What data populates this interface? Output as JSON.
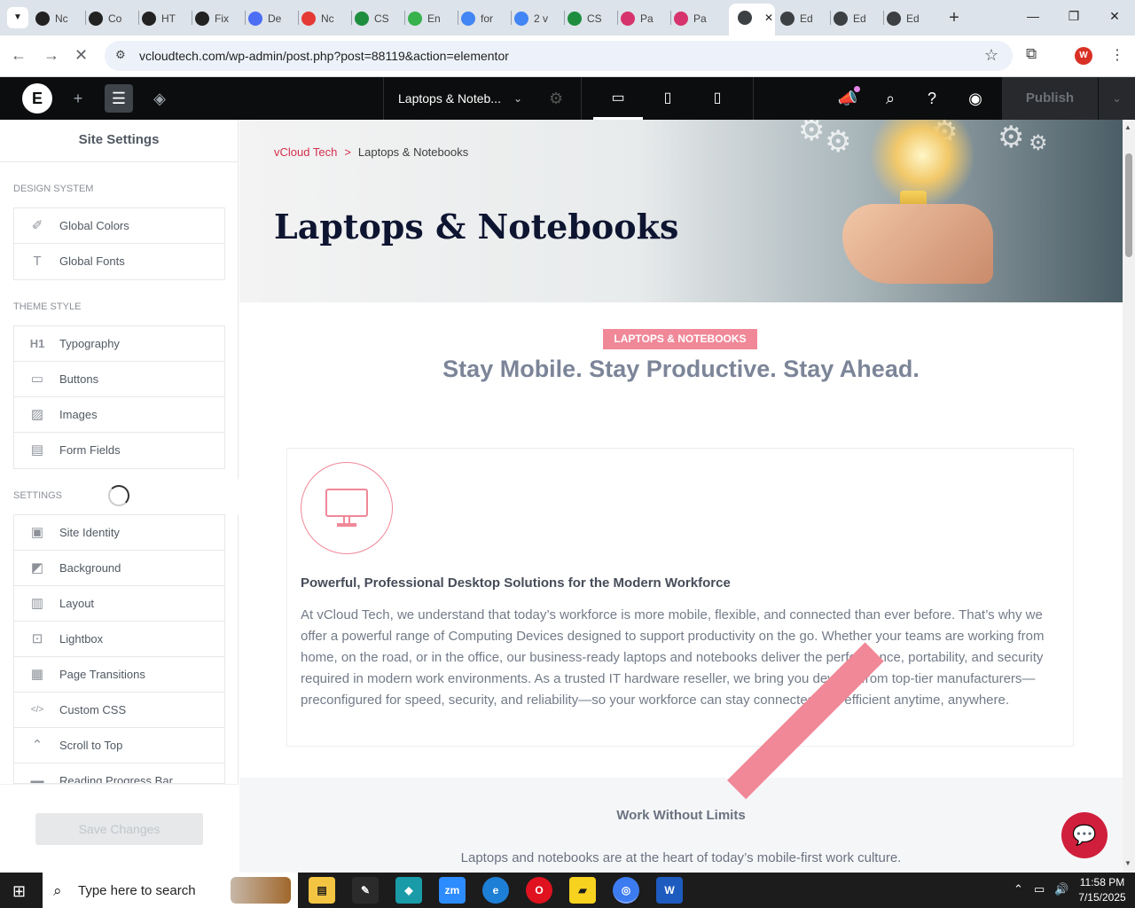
{
  "browser": {
    "tabs": [
      {
        "label": "Nc",
        "color": "#222222"
      },
      {
        "label": "Co",
        "color": "#222222"
      },
      {
        "label": "HT",
        "color": "#222222"
      },
      {
        "label": "Fix",
        "color": "#222222"
      },
      {
        "label": "De",
        "color": "#4c6ef5"
      },
      {
        "label": "Nc",
        "color": "#e53935"
      },
      {
        "label": "CS",
        "color": "#1e8e3e"
      },
      {
        "label": "En",
        "color": "#37b24d"
      },
      {
        "label": "for",
        "color": "#4285f4"
      },
      {
        "label": "2 v",
        "color": "#4285f4"
      },
      {
        "label": "CS",
        "color": "#1e8e3e"
      },
      {
        "label": "Pa",
        "color": "#d6336c"
      },
      {
        "label": "Pa",
        "color": "#d6336c"
      },
      {
        "label": "",
        "color": "#3c4043"
      },
      {
        "label": "Ed",
        "color": "#3c4043"
      },
      {
        "label": "Ed",
        "color": "#3c4043"
      },
      {
        "label": "Ed",
        "color": "#3c4043"
      }
    ],
    "url": "vcloudtech.com/wp-admin/post.php?post=88119&action=elementor",
    "profile_initial": "W"
  },
  "editor": {
    "document_title": "Laptops & Noteb...",
    "publish_label": "Publish"
  },
  "panel": {
    "title": "Site Settings",
    "design_system_label": "DESIGN SYSTEM",
    "design_system": [
      {
        "label": "Global Colors",
        "icon": "brush-icon"
      },
      {
        "label": "Global Fonts",
        "icon": "font-icon"
      }
    ],
    "theme_style_label": "THEME STYLE",
    "theme_style": [
      {
        "label": "Typography",
        "icon": "heading-icon"
      },
      {
        "label": "Buttons",
        "icon": "button-icon"
      },
      {
        "label": "Images",
        "icon": "image-icon"
      },
      {
        "label": "Form Fields",
        "icon": "form-icon"
      }
    ],
    "settings_label": "SETTINGS",
    "settings": [
      {
        "label": "Site Identity",
        "icon": "identity-icon"
      },
      {
        "label": "Background",
        "icon": "background-icon"
      },
      {
        "label": "Layout",
        "icon": "layout-icon"
      },
      {
        "label": "Lightbox",
        "icon": "lightbox-icon"
      },
      {
        "label": "Page Transitions",
        "icon": "transitions-icon"
      },
      {
        "label": "Custom CSS",
        "icon": "code-icon"
      },
      {
        "label": "Scroll to Top",
        "icon": "scroll-top-icon"
      },
      {
        "label": "Reading Progress Bar",
        "icon": "progress-icon"
      }
    ],
    "save_label": "Save Changes"
  },
  "page": {
    "breadcrumb_home": "vCloud Tech",
    "breadcrumb_sep": ">",
    "breadcrumb_current": "Laptops & Notebooks",
    "hero_title": "Laptops & Notebooks",
    "badge": "LAPTOPS & NOTEBOOKS",
    "tagline": "Stay Mobile. Stay Productive. Stay Ahead.",
    "card_heading": "Powerful, Professional Desktop Solutions for the Modern Workforce",
    "card_body": "At vCloud Tech, we understand that today’s workforce is more mobile, flexible, and connected than ever before. That’s why we offer a powerful range of Computing Devices designed to support productivity on the go. Whether your teams are working from home, on the road, or in the office, our business-ready laptops and notebooks deliver the performance, portability, and security required in modern work environments. As a trusted IT hardware reseller, we bring you devices from top-tier manufacturers—preconfigured for speed, security, and reliability—so your workforce can stay connected and efficient anytime, anywhere.",
    "lower_heading": "Work Without Limits",
    "lower_body": "Laptops and notebooks are at the heart of today’s mobile-first work culture.",
    "accent_color": "#f08898",
    "brand_color": "#d5314d"
  },
  "taskbar": {
    "search_placeholder": "Type here to search",
    "time": "11:58 PM",
    "date": "7/15/2025"
  }
}
